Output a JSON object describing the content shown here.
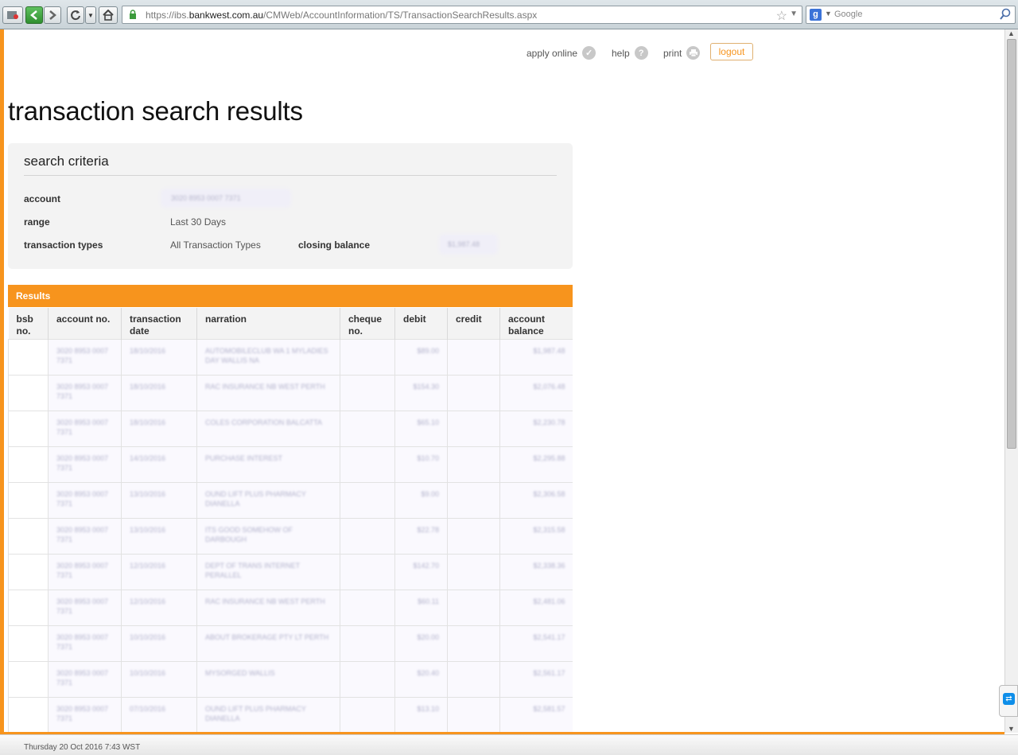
{
  "browser": {
    "url_prefix": "https://ibs.",
    "url_domain": "bankwest.com.au",
    "url_path": "/CMWeb/AccountInformation/TS/TransactionSearchResults.aspx",
    "search_placeholder": "Google",
    "status_text": "Thursday 20 Oct 2016 7:43 WST"
  },
  "toplinks": {
    "apply_online": "apply online",
    "help": "help",
    "print": "print",
    "logout": "logout"
  },
  "page": {
    "title": "transaction search results"
  },
  "criteria": {
    "heading": "search criteria",
    "account_label": "account",
    "account_value": "3020 8953 0007 7371",
    "range_label": "range",
    "range_value": "Last 30 Days",
    "types_label": "transaction types",
    "types_value": "All Transaction Types",
    "closing_label": "closing balance",
    "closing_value": "$1,987.48"
  },
  "results": {
    "heading": "Results",
    "columns": {
      "bsb": "bsb no.",
      "account": "account no.",
      "date": "transaction date",
      "narration": "narration",
      "cheque": "cheque no.",
      "debit": "debit",
      "credit": "credit",
      "balance": "account balance"
    },
    "rows": [
      {
        "account": "3020 8953 0007 7371",
        "date": "18/10/2016",
        "narration": "AUTOMOBILECLUB WA 1 MYLADIES DAY WALLIS NA",
        "debit": "$89.00",
        "balance": "$1,987.48"
      },
      {
        "account": "3020 8953 0007 7371",
        "date": "18/10/2016",
        "narration": "RAC INSURANCE NB WEST PERTH",
        "debit": "$154.30",
        "balance": "$2,076.48"
      },
      {
        "account": "3020 8953 0007 7371",
        "date": "18/10/2016",
        "narration": "COLES CORPORATION BALCATTA",
        "debit": "$65.10",
        "balance": "$2,230.78"
      },
      {
        "account": "3020 8953 0007 7371",
        "date": "14/10/2016",
        "narration": "PURCHASE INTEREST",
        "debit": "$10.70",
        "balance": "$2,295.88"
      },
      {
        "account": "3020 8953 0007 7371",
        "date": "13/10/2016",
        "narration": "OUND LIFT PLUS PHARMACY DIANELLA",
        "debit": "$9.00",
        "balance": "$2,306.58"
      },
      {
        "account": "3020 8953 0007 7371",
        "date": "13/10/2016",
        "narration": "ITS GOOD SOMEHOW OF DARBOUGH",
        "debit": "$22.78",
        "balance": "$2,315.58"
      },
      {
        "account": "3020 8953 0007 7371",
        "date": "12/10/2016",
        "narration": "DEPT OF TRANS INTERNET PERALLEL",
        "debit": "$142.70",
        "balance": "$2,338.36"
      },
      {
        "account": "3020 8953 0007 7371",
        "date": "12/10/2016",
        "narration": "RAC INSURANCE NB WEST PERTH",
        "debit": "$60.11",
        "balance": "$2,481.06"
      },
      {
        "account": "3020 8953 0007 7371",
        "date": "10/10/2016",
        "narration": "ABOUT BROKERAGE PTY LT PERTH",
        "debit": "$20.00",
        "balance": "$2,541.17"
      },
      {
        "account": "3020 8953 0007 7371",
        "date": "10/10/2016",
        "narration": "MYSORGED WALLIS",
        "debit": "$20.40",
        "balance": "$2,561.17"
      },
      {
        "account": "3020 8953 0007 7371",
        "date": "07/10/2016",
        "narration": "OUND LIFT PLUS PHARMACY DIANELLA",
        "debit": "$13.10",
        "balance": "$2,581.57"
      }
    ]
  },
  "colors": {
    "accent": "#f7941d",
    "panel": "#f3f3f3"
  }
}
